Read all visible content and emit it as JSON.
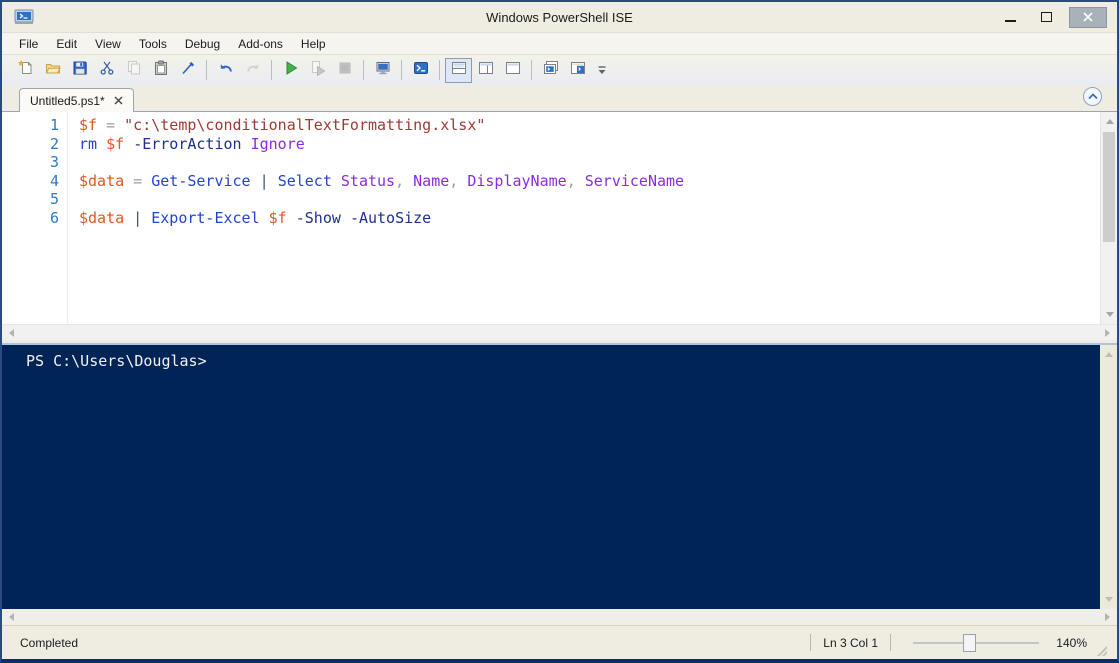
{
  "window": {
    "title": "Windows PowerShell ISE"
  },
  "menus": [
    "File",
    "Edit",
    "View",
    "Tools",
    "Debug",
    "Add-ons",
    "Help"
  ],
  "toolbar": {
    "groups": [
      [
        {
          "icon": "new-script"
        },
        {
          "icon": "open-script"
        },
        {
          "icon": "save-script"
        },
        {
          "icon": "cut"
        },
        {
          "icon": "copy",
          "disabled": true
        },
        {
          "icon": "paste"
        },
        {
          "icon": "clear-console-pane"
        }
      ],
      [
        {
          "icon": "undo"
        },
        {
          "icon": "redo",
          "disabled": true
        }
      ],
      [
        {
          "icon": "run-script"
        },
        {
          "icon": "run-selection",
          "disabled": true
        },
        {
          "icon": "stop-operation",
          "disabled": true
        }
      ],
      [
        {
          "icon": "new-remote-powershell-tab"
        }
      ],
      [
        {
          "icon": "start-powershell"
        }
      ],
      [
        {
          "icon": "show-script-pane-top",
          "selected": true
        },
        {
          "icon": "show-script-pane-right"
        },
        {
          "icon": "show-script-pane-maximized"
        }
      ],
      [
        {
          "icon": "new-powershell-tab"
        },
        {
          "icon": "show-powershell-window"
        }
      ]
    ]
  },
  "tab": {
    "label": "Untitled5.ps1*"
  },
  "editor": {
    "lines": [
      {
        "n": "1",
        "tokens": [
          {
            "t": "var",
            "s": "$f"
          },
          {
            "t": "op",
            "s": " = "
          },
          {
            "t": "str",
            "s": "\"c:\\temp\\conditionalTextFormatting.xlsx\""
          }
        ]
      },
      {
        "n": "2",
        "tokens": [
          {
            "t": "cmd",
            "s": "rm"
          },
          {
            "t": "pln",
            "s": " "
          },
          {
            "t": "var",
            "s": "$f"
          },
          {
            "t": "pln",
            "s": " "
          },
          {
            "t": "param",
            "s": "-ErrorAction"
          },
          {
            "t": "pln",
            "s": " "
          },
          {
            "t": "arg",
            "s": "Ignore"
          }
        ]
      },
      {
        "n": "3",
        "tokens": []
      },
      {
        "n": "4",
        "tokens": [
          {
            "t": "var",
            "s": "$data"
          },
          {
            "t": "op",
            "s": " = "
          },
          {
            "t": "cmd",
            "s": "Get-Service"
          },
          {
            "t": "pipe",
            "s": " | "
          },
          {
            "t": "cmd",
            "s": "Select"
          },
          {
            "t": "pln",
            "s": " "
          },
          {
            "t": "arg",
            "s": "Status"
          },
          {
            "t": "op",
            "s": ", "
          },
          {
            "t": "arg",
            "s": "Name"
          },
          {
            "t": "op",
            "s": ", "
          },
          {
            "t": "arg",
            "s": "DisplayName"
          },
          {
            "t": "op",
            "s": ", "
          },
          {
            "t": "arg",
            "s": "ServiceName"
          }
        ]
      },
      {
        "n": "5",
        "tokens": []
      },
      {
        "n": "6",
        "tokens": [
          {
            "t": "var",
            "s": "$data"
          },
          {
            "t": "pipe",
            "s": " | "
          },
          {
            "t": "cmd",
            "s": "Export-Excel"
          },
          {
            "t": "pln",
            "s": " "
          },
          {
            "t": "var",
            "s": "$f"
          },
          {
            "t": "pln",
            "s": " "
          },
          {
            "t": "param",
            "s": "-Show"
          },
          {
            "t": "pln",
            "s": " "
          },
          {
            "t": "param",
            "s": "-AutoSize"
          }
        ]
      }
    ]
  },
  "console": {
    "prompt": "PS C:\\Users\\Douglas>"
  },
  "statusbar": {
    "status": "Completed",
    "position": "Ln 3 Col 1",
    "zoom": "140%"
  },
  "colors": {
    "console_background": "#012456",
    "chrome_background": "#efede2",
    "accent_blue": "#2e71c6",
    "variable": "#e2571c",
    "string": "#9e3a33",
    "command": "#2443ce",
    "parameter": "#1e2f8f",
    "argument": "#8a2be2",
    "line_number": "#2f79c2"
  }
}
